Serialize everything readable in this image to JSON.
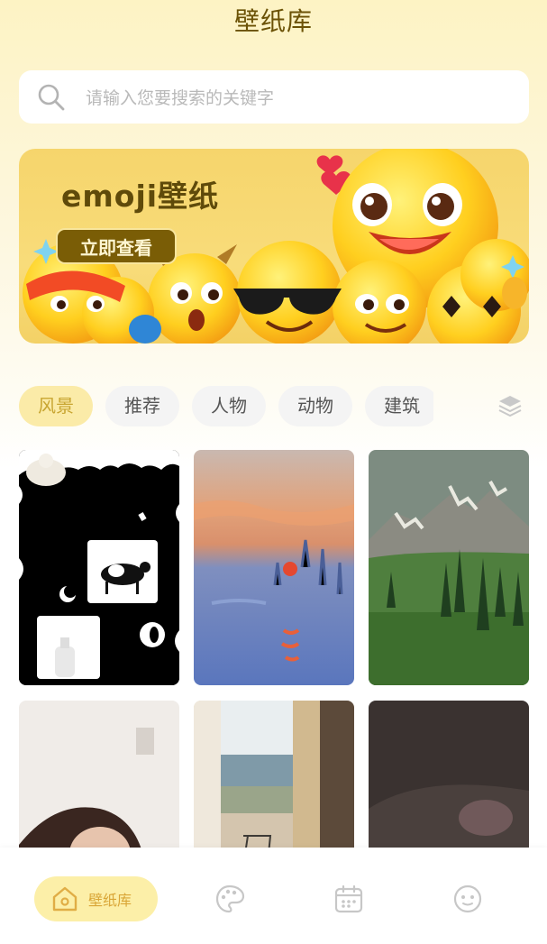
{
  "header": {
    "title": "壁纸库"
  },
  "search": {
    "placeholder": "请输入您要搜索的关键字",
    "icon": "search-icon"
  },
  "banner": {
    "title": "emoji壁纸",
    "button_label": "立即查看",
    "background_color": "#f6d56c"
  },
  "categories": {
    "items": [
      {
        "label": "风景",
        "active": true
      },
      {
        "label": "推荐",
        "active": false
      },
      {
        "label": "人物",
        "active": false
      },
      {
        "label": "动物",
        "active": false
      },
      {
        "label": "建筑",
        "active": false
      }
    ],
    "more_icon": "layers-icon"
  },
  "wallpapers": [
    {
      "theme": "milk-cow-poster"
    },
    {
      "theme": "impressionist-sunrise"
    },
    {
      "theme": "mountain-meadow"
    },
    {
      "theme": "portrait-girl"
    },
    {
      "theme": "balcony-door"
    },
    {
      "theme": "dark-abstract"
    }
  ],
  "tabbar": {
    "items": [
      {
        "icon": "home-icon",
        "label": "壁纸库",
        "active": true
      },
      {
        "icon": "palette-icon"
      },
      {
        "icon": "calendar-icon"
      },
      {
        "icon": "smiley-icon"
      }
    ],
    "accent_color": "#fcefa8"
  }
}
